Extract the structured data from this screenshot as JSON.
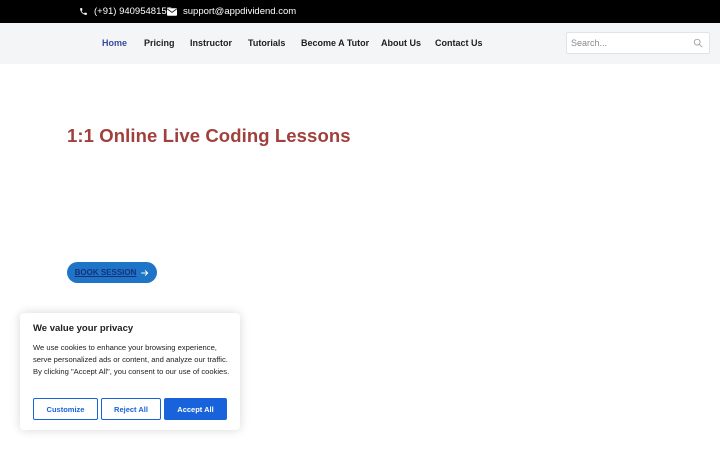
{
  "topbar": {
    "phone": "(+91) 9409548155",
    "email": "support@appdividend.com"
  },
  "nav": {
    "items": [
      {
        "label": "Home",
        "active": true
      },
      {
        "label": "Pricing"
      },
      {
        "label": "Instructor"
      },
      {
        "label": "Tutorials"
      },
      {
        "label": "Become A Tutor"
      },
      {
        "label": "About Us"
      },
      {
        "label": "Contact Us"
      }
    ],
    "active_color": "#3b4ba0"
  },
  "search": {
    "placeholder": "Search...",
    "value": ""
  },
  "hero": {
    "title": "1:1 Online Live Coding Lessons",
    "title_color": "#a0403c",
    "cta_label": "BOOK SESSION",
    "cta_color": "#1e74c6"
  },
  "cookie_banner": {
    "title": "We value your privacy",
    "text": "We use cookies to enhance your browsing experience, serve personalized ads or content, and analyze our traffic. By clicking \"Accept All\", you consent to our use of cookies.",
    "customize_label": "Customize",
    "reject_label": "Reject All",
    "accept_label": "Accept All",
    "accent": "#1863dc"
  },
  "icons": {
    "phone": "phone-icon",
    "email": "envelope-icon",
    "search": "search-icon",
    "cta": "arrow-right-icon"
  }
}
